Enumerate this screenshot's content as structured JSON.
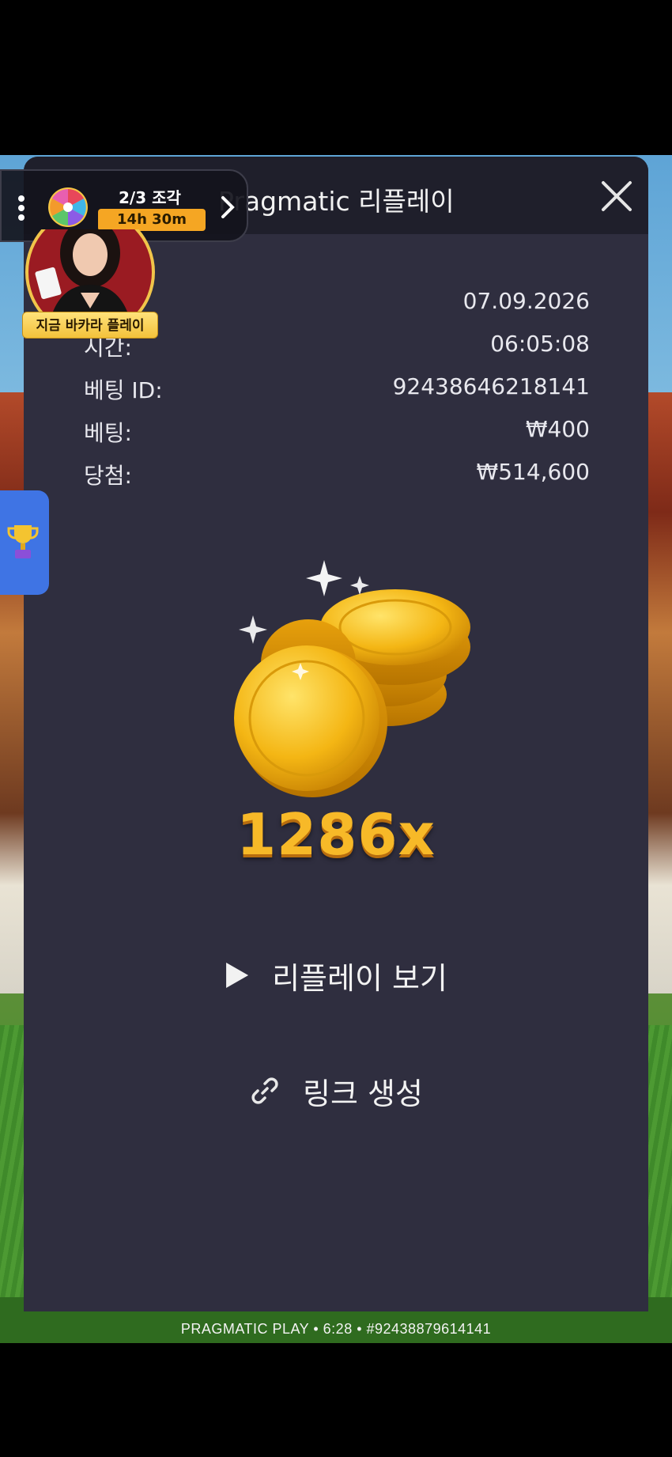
{
  "background": {
    "win_text": "",
    "meta_text": "PRAGMATIC PLAY • 6:28 • #92438879614141"
  },
  "modal": {
    "title": "Pragmatic 리플레이",
    "close_icon": "close-x",
    "info": {
      "date_value": "07.09.2026",
      "time_label": "시간:",
      "time_value": "06:05:08",
      "bet_id_label": "베팅 ID:",
      "bet_id_value": "92438646218141",
      "bet_label": "베팅:",
      "bet_value": "₩400",
      "win_label": "당첨:",
      "win_value": "₩514,600"
    },
    "multiplier": "1286x",
    "actions": {
      "watch_replay": "리플레이 보기",
      "create_link": "링크 생성"
    }
  },
  "promo": {
    "progress": "2/3 조각",
    "timer": "14h 30m",
    "baccarat_cta": "지금 바카라 플레이"
  },
  "colors": {
    "modal_bg": "#2f2e3f",
    "header_bg": "#1f1f2b",
    "multiplier_gold": "#f7b928",
    "timer_orange": "#f5a623",
    "trophy_tab_blue": "#3f74e4"
  }
}
